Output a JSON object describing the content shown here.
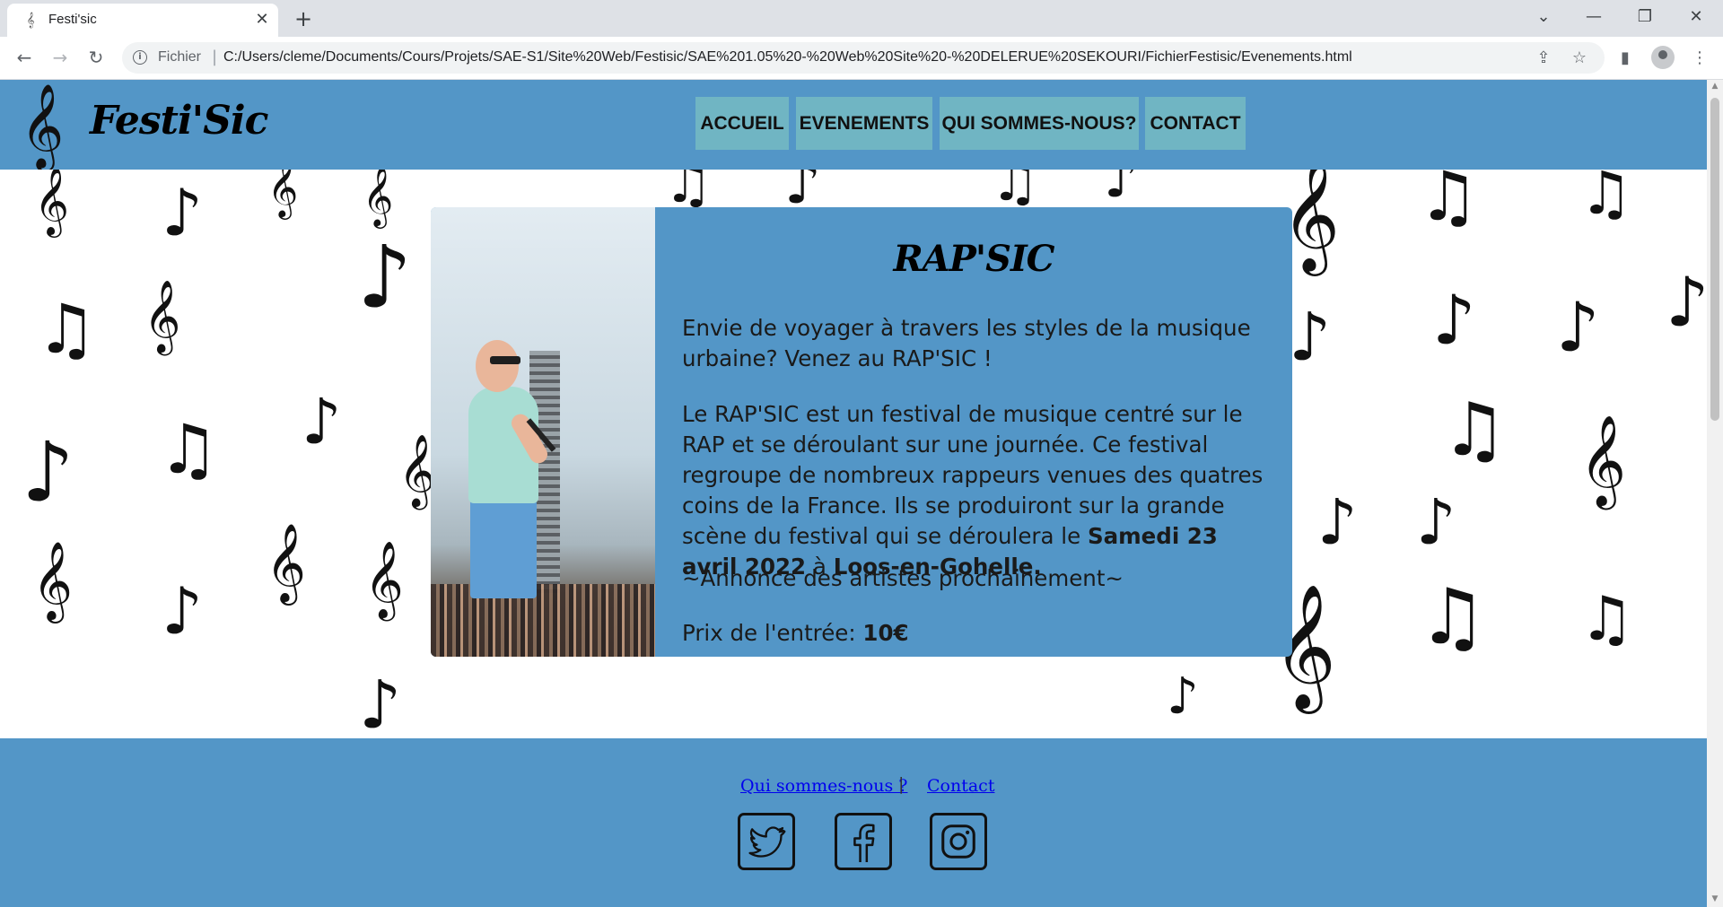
{
  "browser": {
    "tab_title": "Festi'sic",
    "tab_favicon": "𝄞",
    "close_glyph": "✕",
    "new_tab_glyph": "+",
    "url_chip": "Fichier",
    "url_separator": "|",
    "url": "C:/Users/cleme/Documents/Cours/Projets/SAE-S1/Site%20Web/Festisic/SAE%201.05%20-%20Web%20Site%20-%20DELERUE%20SEKOURI/FichierFestisic/Evenements.html",
    "back_glyph": "←",
    "forward_glyph": "→",
    "reload_glyph": "↻",
    "dropdown_glyph": "⌄",
    "minimize_glyph": "—",
    "restore_glyph": "❐",
    "win_close_glyph": "✕",
    "share_glyph": "⇪",
    "bookmark_glyph": "☆",
    "sidepanel_glyph": "▮",
    "menu_glyph": "⋮",
    "info_glyph": "i"
  },
  "site": {
    "logo_glyph": "𝄞",
    "logo_text": "Festi'Sic",
    "nav": [
      {
        "label": "ACCUEIL"
      },
      {
        "label": "EVENEMENTS"
      },
      {
        "label": "QUI SOMMES-NOUS?"
      },
      {
        "label": "CONTACT"
      }
    ],
    "note_glyphs": {
      "eighth": "♪",
      "beamed": "♫",
      "clef": "𝄞"
    }
  },
  "event": {
    "title": "RAP'SIC",
    "intro": "Envie de voyager à travers les styles de la musique urbaine? Venez au RAP'SIC !",
    "description_start": "Le RAP'SIC est un festival de musique centré sur le RAP et se déroulant sur une journée. Ce festival regroupe de nombreux rappeurs venues des quatres coins de la France. Ils se produiront sur la grande scène du festival qui se déroulera le ",
    "date": "Samedi 23 avril 2022",
    "date_connector": " à ",
    "location": "Loos-en-Gohelle.",
    "announcement": "~Annonce des artistes prochainement~",
    "price_label": "Prix de l'entrée: ",
    "price": "10€"
  },
  "footer": {
    "link_about": "Qui sommes-nous ?",
    "separator": "|",
    "link_contact": "Contact",
    "socials": [
      {
        "icon": "twitter-icon"
      },
      {
        "icon": "facebook-icon"
      },
      {
        "icon": "instagram-icon"
      }
    ]
  },
  "colors": {
    "header_blue": "#5396c7",
    "nav_teal": "#70b5c3",
    "link_blue": "#0000ee"
  }
}
